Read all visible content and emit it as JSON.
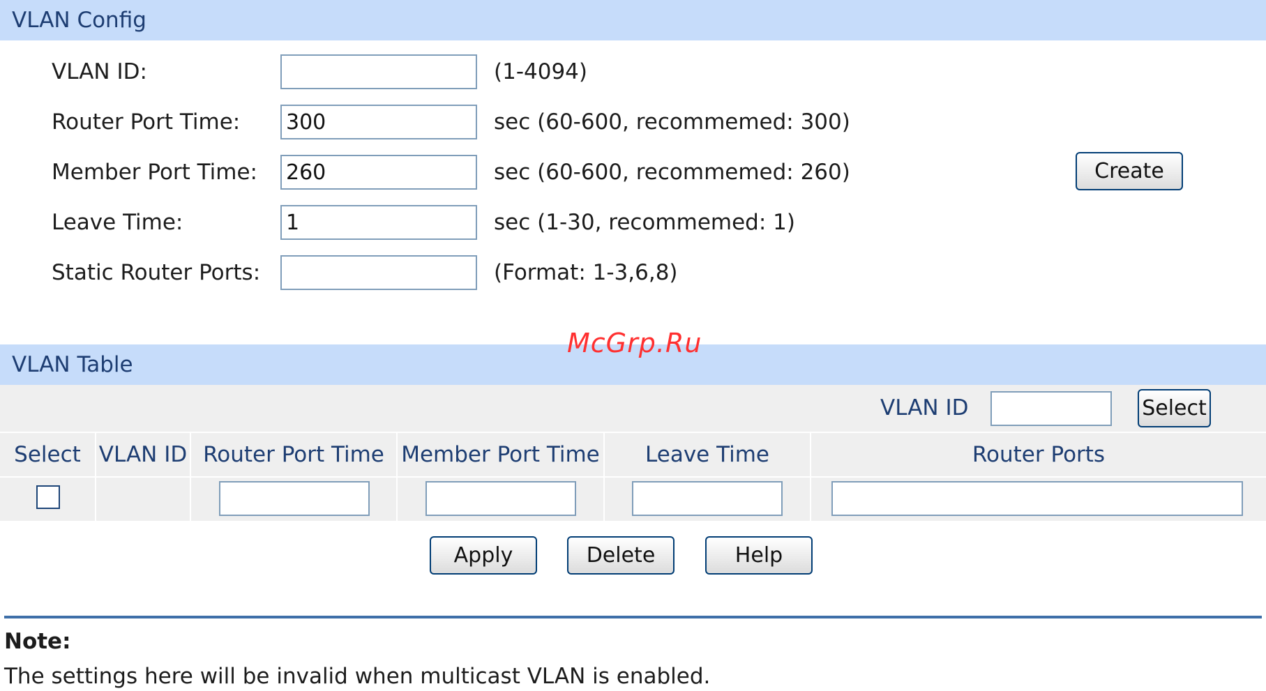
{
  "vlan_config": {
    "header": "VLAN Config",
    "vlan_id": {
      "label": "VLAN ID:",
      "value": "",
      "hint": "(1-4094)"
    },
    "router_port_time": {
      "label": "Router Port Time:",
      "value": "300",
      "hint": "sec (60-600, recommemed: 300)"
    },
    "member_port_time": {
      "label": "Member Port Time:",
      "value": "260",
      "hint": "sec (60-600, recommemed: 260)"
    },
    "leave_time": {
      "label": "Leave Time:",
      "value": "1",
      "hint": "sec (1-30, recommemed: 1)"
    },
    "static_router_ports": {
      "label": "Static Router Ports:",
      "value": "",
      "hint": "(Format: 1-3,6,8)"
    },
    "create_label": "Create"
  },
  "watermark": "McGrp.Ru",
  "vlan_table": {
    "header": "VLAN Table",
    "filter": {
      "label": "VLAN ID",
      "value": "",
      "select_label": "Select"
    },
    "columns": [
      "Select",
      "VLAN ID",
      "Router Port Time",
      "Member Port Time",
      "Leave Time",
      "Router Ports"
    ],
    "edit_row": {
      "checked": false,
      "router_port_time": "",
      "member_port_time": "",
      "leave_time": "",
      "router_ports": ""
    }
  },
  "actions": {
    "apply": "Apply",
    "delete": "Delete",
    "help": "Help"
  },
  "note": {
    "title": "Note:",
    "text": "The settings here will be invalid when multicast VLAN is enabled."
  },
  "colors": {
    "header_bg": "#c6dcfa",
    "header_text": "#1d3d72",
    "table_bg": "#efefef",
    "divider": "#3e6fa8"
  }
}
